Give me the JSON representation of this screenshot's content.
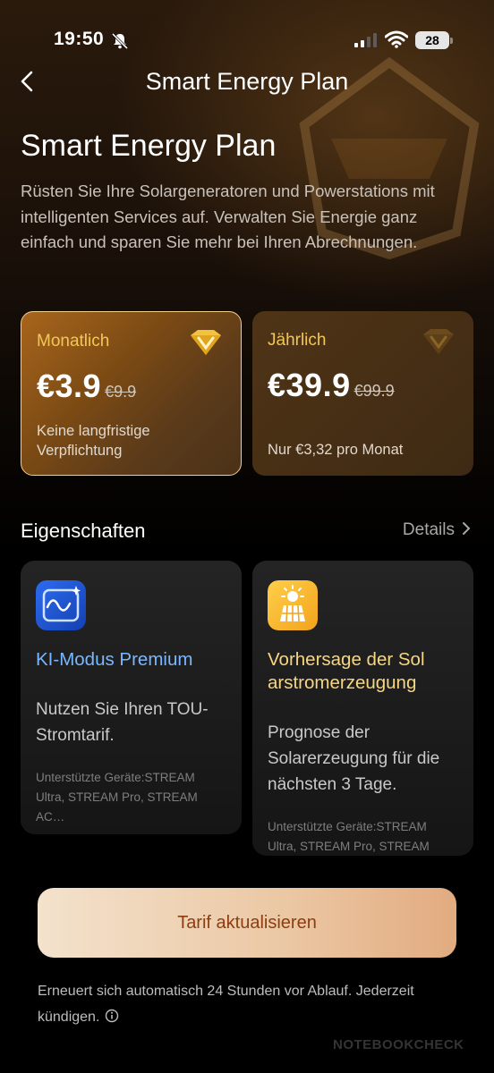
{
  "status": {
    "time": "19:50",
    "battery": "28"
  },
  "nav": {
    "title": "Smart Energy Plan"
  },
  "hero": {
    "title": "Smart Energy Plan",
    "description": "Rüsten Sie Ihre Solargeneratoren und Powerstations mit intelligenten Services auf. Verwalten Sie Energie ganz einfach und sparen Sie mehr bei Ihren Abrechnungen."
  },
  "plans": [
    {
      "name": "Monatlich",
      "price": "€3.9",
      "old_price": "€9.9",
      "note": "Keine langfristige Verpflichtung",
      "selected": true
    },
    {
      "name": "Jährlich",
      "price": "€39.9",
      "old_price": "€99.9",
      "note": "Nur €3,32 pro Monat",
      "selected": false
    }
  ],
  "features": {
    "title": "Eigenschaften",
    "details_label": "Details",
    "cards": [
      {
        "icon": "ai-wave-icon",
        "title": "KI-Modus Premium",
        "text": "Nutzen Sie Ihren TOU-Stromtarif.",
        "sub": "Unterstützte Geräte:STREAM Ultra, STREAM Pro, STREAM AC…"
      },
      {
        "icon": "solar-panel-icon",
        "title": "Vorhersage der Sol arstromerzeugung",
        "text": "Prognose der Solarerzeugung für die nächsten 3 Tage.",
        "sub": "Unterstützte Geräte:STREAM Ultra, STREAM Pro, STREAM AC…"
      }
    ]
  },
  "cta": {
    "label": "Tarif aktualisieren"
  },
  "footer": {
    "text": "Erneuert sich automatisch 24 Stunden vor Ablauf. Jederzeit kündigen."
  },
  "watermark": "NOTEBOOKCHECK",
  "colors": {
    "accent_gold": "#f2c75a",
    "ai_blue": "#79b7ff",
    "solar_yellow": "#f6d682",
    "cta_text": "#8c3d11"
  }
}
